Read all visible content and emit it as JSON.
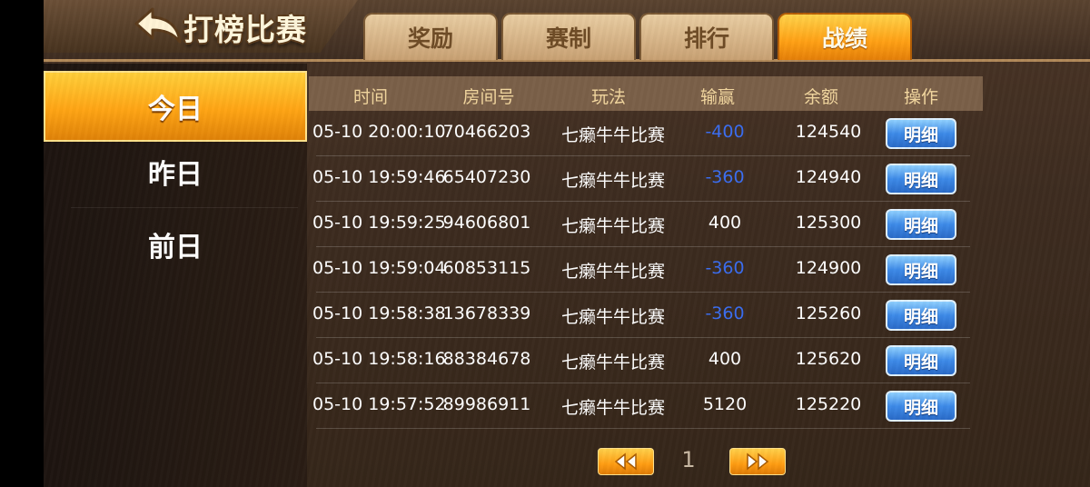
{
  "header": {
    "title": "打榜比赛",
    "tabs": [
      {
        "label": "奖励"
      },
      {
        "label": "赛制"
      },
      {
        "label": "排行"
      },
      {
        "label": "战绩"
      }
    ]
  },
  "sidebar": {
    "items": [
      {
        "label": "今日"
      },
      {
        "label": "昨日"
      },
      {
        "label": "前日"
      }
    ]
  },
  "table": {
    "headers": [
      "时间",
      "房间号",
      "玩法",
      "输赢",
      "余额",
      "操作"
    ],
    "rows": [
      {
        "time": "05-10 20:00:10",
        "room": "70466203",
        "mode": "七癞牛牛比赛",
        "result": "-400",
        "balance": "124540",
        "action": "明细"
      },
      {
        "time": "05-10 19:59:46",
        "room": "65407230",
        "mode": "七癞牛牛比赛",
        "result": "-360",
        "balance": "124940",
        "action": "明细"
      },
      {
        "time": "05-10 19:59:25",
        "room": "94606801",
        "mode": "七癞牛牛比赛",
        "result": "400",
        "balance": "125300",
        "action": "明细"
      },
      {
        "time": "05-10 19:59:04",
        "room": "60853115",
        "mode": "七癞牛牛比赛",
        "result": "-360",
        "balance": "124900",
        "action": "明细"
      },
      {
        "time": "05-10 19:58:38",
        "room": "13678339",
        "mode": "七癞牛牛比赛",
        "result": "-360",
        "balance": "125260",
        "action": "明细"
      },
      {
        "time": "05-10 19:58:16",
        "room": "88384678",
        "mode": "七癞牛牛比赛",
        "result": "400",
        "balance": "125620",
        "action": "明细"
      },
      {
        "time": "05-10 19:57:52",
        "room": "89986911",
        "mode": "七癞牛牛比赛",
        "result": "5120",
        "balance": "125220",
        "action": "明细"
      }
    ]
  },
  "pager": {
    "page": "1",
    "prev_icon": "double-left-arrow-icon",
    "next_icon": "double-right-arrow-icon"
  },
  "colors": {
    "accent": "#ffa514",
    "negative": "#3a6df0",
    "button_blue": "#3d8ae8"
  }
}
